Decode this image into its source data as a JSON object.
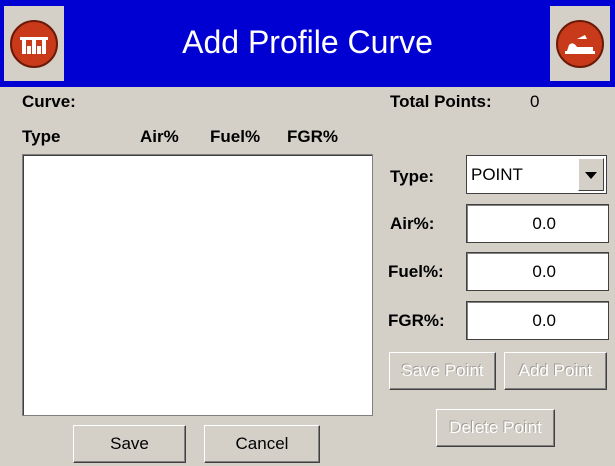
{
  "title": "Add Profile Curve",
  "colors": {
    "titlebar": "#0000d2",
    "icon_red": "#c93a1a"
  },
  "icons": {
    "left": "home-icon",
    "right": "exit-icon"
  },
  "labels": {
    "curve": "Curve:",
    "total_points": "Total Points:",
    "type": "Type:",
    "air": "Air%:",
    "fuel": "Fuel%:",
    "fgr": "FGR%:"
  },
  "total_points_value": "0",
  "columns": [
    "Type",
    "Air%",
    "Fuel%",
    "FGR%"
  ],
  "type_select": {
    "selected": "POINT"
  },
  "fields": {
    "air": "0.0",
    "fuel": "0.0",
    "fgr": "0.0"
  },
  "buttons": {
    "save_point": "Save Point",
    "add_point": "Add Point",
    "delete_point": "Delete Point",
    "save": "Save",
    "cancel": "Cancel"
  }
}
